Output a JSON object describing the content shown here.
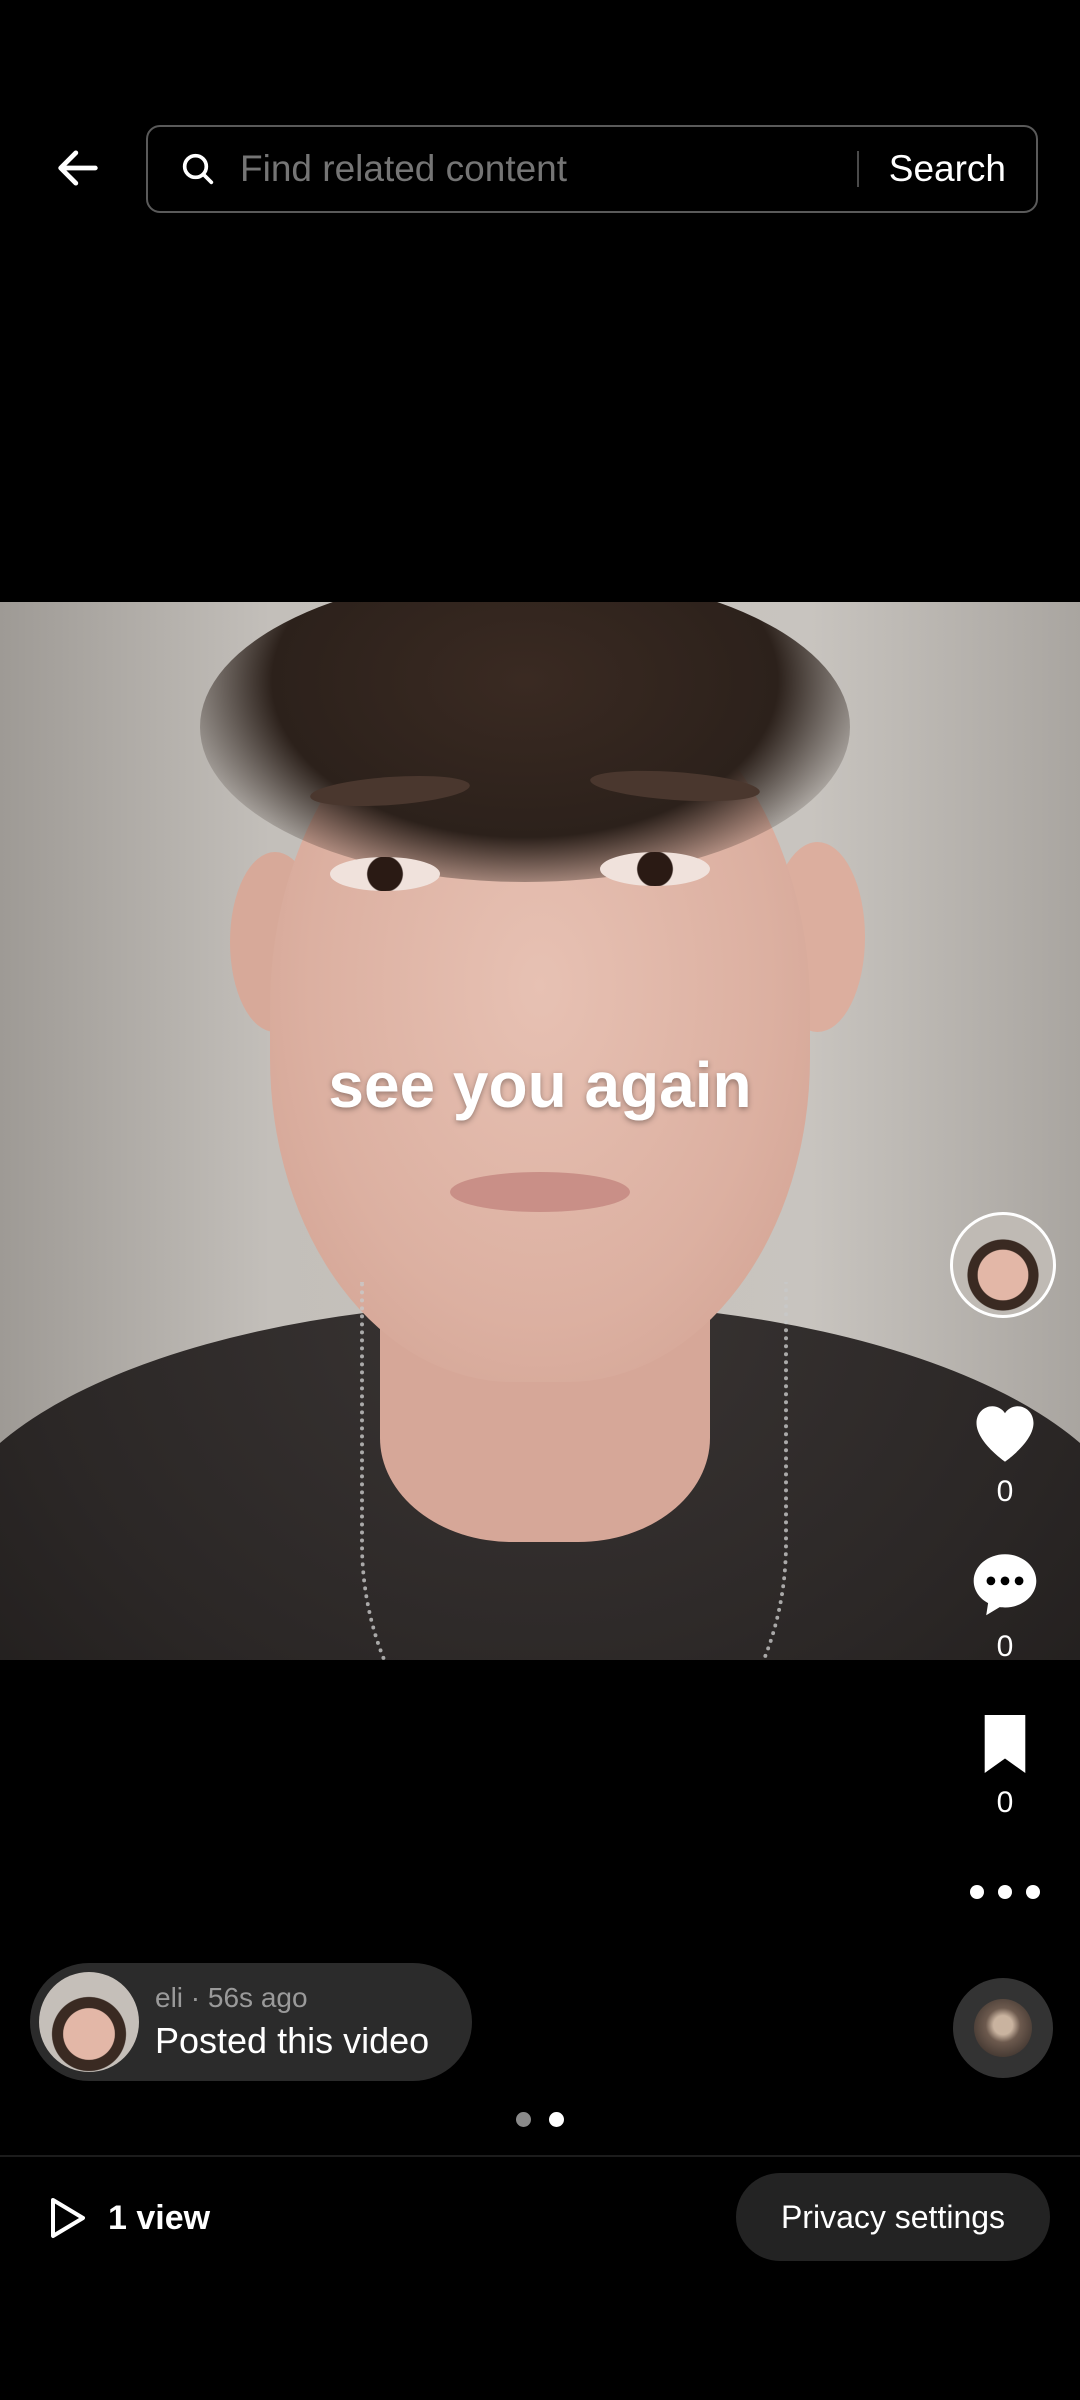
{
  "search": {
    "placeholder": "Find related content",
    "button_label": "Search"
  },
  "video": {
    "overlay_text": "see you again"
  },
  "rail": {
    "likes": "0",
    "comments": "0",
    "saves": "0"
  },
  "post": {
    "username": "eli",
    "meta": "eli · 56s ago",
    "action": "Posted this video"
  },
  "pagination": {
    "total": 2,
    "current": 2
  },
  "footer": {
    "views": "1 view",
    "privacy_label": "Privacy settings"
  },
  "icons": [
    "back-arrow-icon",
    "search-icon",
    "heart-icon",
    "comment-icon",
    "bookmark-icon",
    "more-icon",
    "play-icon",
    "music-disc-icon"
  ]
}
